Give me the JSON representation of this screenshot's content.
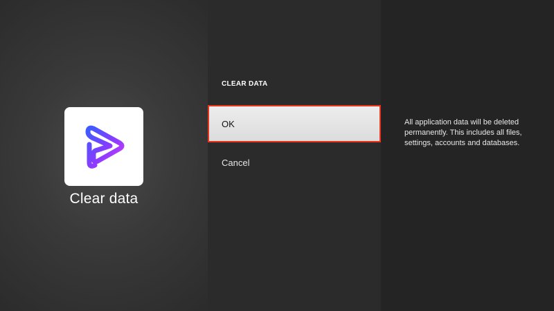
{
  "app": {
    "title": "Clear data",
    "icon": "play-logo-icon",
    "icon_gradient": [
      "#3b5cff",
      "#8a3bff",
      "#d23bff"
    ]
  },
  "dialog": {
    "heading": "CLEAR DATA",
    "options": [
      {
        "label": "OK",
        "focused": true
      },
      {
        "label": "Cancel",
        "focused": false
      }
    ],
    "description": "All application data will be deleted permanently. This includes all files, settings, accounts and databases."
  },
  "colors": {
    "focus_border": "#e8341d",
    "focus_fill": "#e6e6e6"
  }
}
